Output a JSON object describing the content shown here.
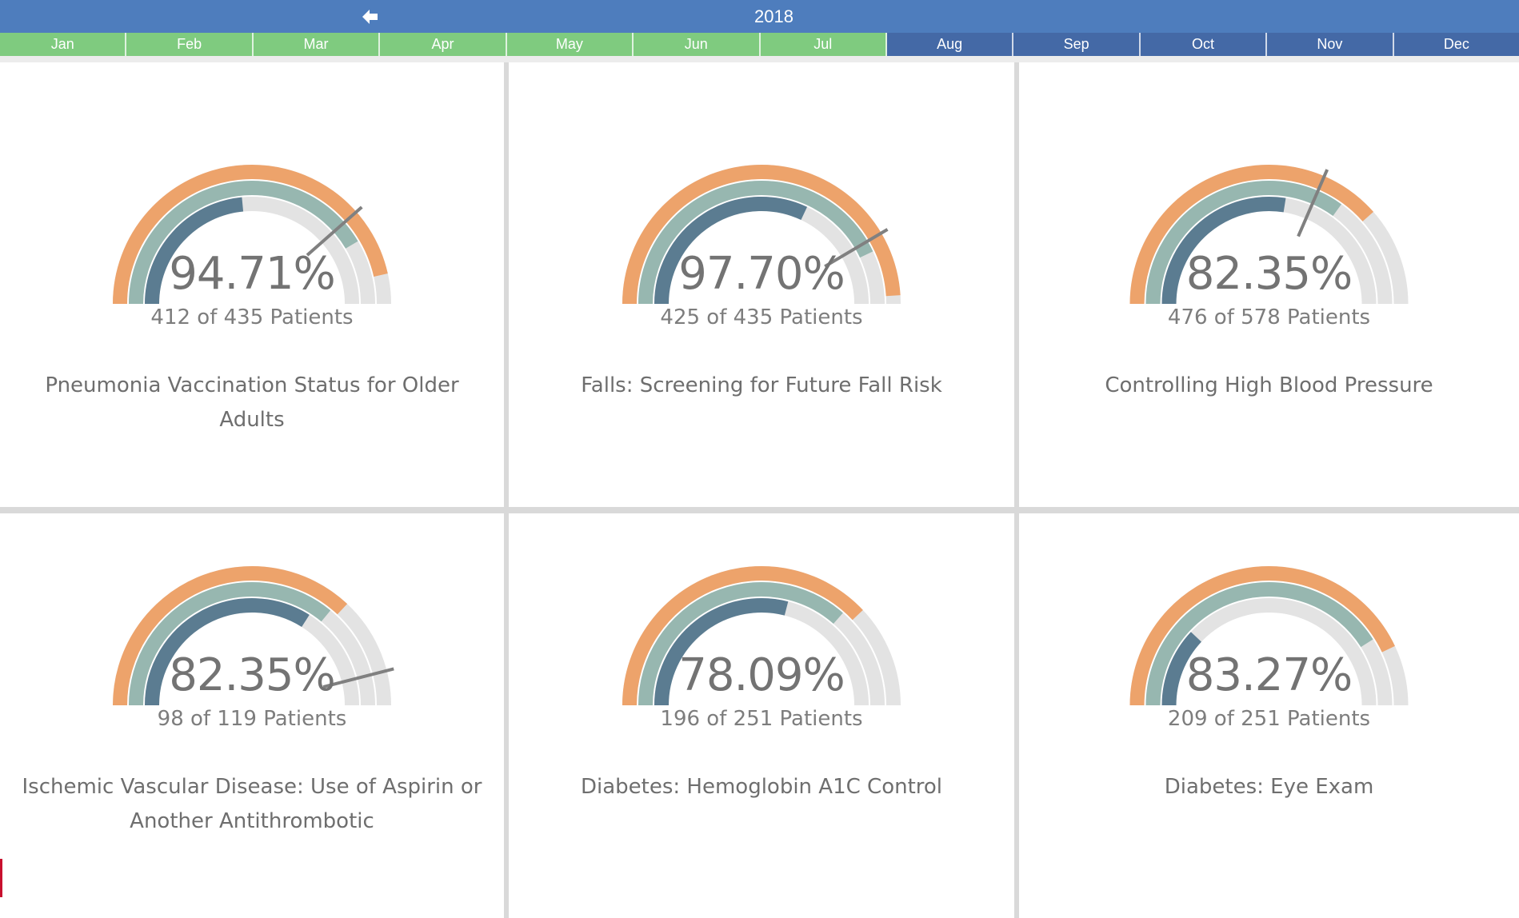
{
  "calendar": {
    "year": "2018",
    "prev_icon": "arrow-left-icon",
    "months": [
      {
        "label": "Jan",
        "state": "past"
      },
      {
        "label": "Feb",
        "state": "past"
      },
      {
        "label": "Mar",
        "state": "past"
      },
      {
        "label": "Apr",
        "state": "past"
      },
      {
        "label": "May",
        "state": "past"
      },
      {
        "label": "Jun",
        "state": "past"
      },
      {
        "label": "Jul",
        "state": "past"
      },
      {
        "label": "Aug",
        "state": "future"
      },
      {
        "label": "Sep",
        "state": "future"
      },
      {
        "label": "Oct",
        "state": "future"
      },
      {
        "label": "Nov",
        "state": "future"
      },
      {
        "label": "Dec",
        "state": "future"
      }
    ]
  },
  "colors": {
    "header": "#4e7dbd",
    "month_past": "#7fcb7f",
    "month_future": "#4469a6",
    "ring_outer": "#eda36b",
    "ring_middle": "#97b7b0",
    "ring_inner": "#5b7c91",
    "ring_track": "#e3e3e3",
    "target_marker": "#808080",
    "text": "#737373"
  },
  "measures": [
    {
      "percent": "94.71%",
      "patients": "412 of 435 Patients",
      "title": "Pneumonia Vaccination Status for Older Adults",
      "outer_fraction": 0.93,
      "middle_fraction": 0.83,
      "inner_fraction": 0.47,
      "target_fraction": 0.77
    },
    {
      "percent": "97.70%",
      "patients": "425 of 435 Patients",
      "title": "Falls: Screening for Future Fall Risk",
      "outer_fraction": 0.98,
      "middle_fraction": 0.86,
      "inner_fraction": 0.64,
      "target_fraction": 0.83
    },
    {
      "percent": "82.35%",
      "patients": "476 of 578 Patients",
      "title": "Controlling High Blood Pressure",
      "outer_fraction": 0.77,
      "middle_fraction": 0.7,
      "inner_fraction": 0.55,
      "target_fraction": 0.63
    },
    {
      "percent": "82.35%",
      "patients": "98 of 119 Patients",
      "title": "Ischemic Vascular Disease: Use of Aspirin or Another Antithrombotic",
      "outer_fraction": 0.74,
      "middle_fraction": 0.72,
      "inner_fraction": 0.68,
      "target_fraction": 0.92
    },
    {
      "percent": "78.09%",
      "patients": "196 of 251 Patients",
      "title": "Diabetes: Hemoglobin A1C Control",
      "outer_fraction": 0.76,
      "middle_fraction": 0.73,
      "inner_fraction": 0.58,
      "target_fraction": null
    },
    {
      "percent": "83.27%",
      "patients": "209 of 251 Patients",
      "title": "Diabetes: Eye Exam",
      "outer_fraction": 0.86,
      "middle_fraction": 0.82,
      "inner_fraction": 0.24,
      "target_fraction": null
    }
  ]
}
